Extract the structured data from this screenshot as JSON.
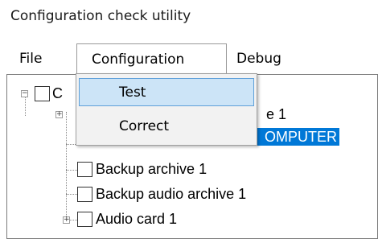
{
  "window": {
    "title": "Configuration check utility"
  },
  "menubar": {
    "file": "File",
    "configuration": "Configuration",
    "debug": "Debug"
  },
  "dropdown": {
    "items": [
      {
        "label": "Test",
        "highlighted": true
      },
      {
        "label": "Correct",
        "highlighted": false
      }
    ]
  },
  "tree": {
    "nodes": [
      {
        "label": "C",
        "expander": "minus"
      },
      {
        "label": "e 1",
        "expander": "plus"
      },
      {
        "label": "OMPUTER",
        "selected": true
      },
      {
        "label": "Backup archive 1"
      },
      {
        "label": "Backup audio archive 1"
      },
      {
        "label": "Audio card 1",
        "expander": "plus"
      }
    ]
  },
  "colors": {
    "selection": "#0078d7",
    "menu_highlight": "#cce4f7",
    "menu_highlight_border": "#5fa0d9"
  }
}
